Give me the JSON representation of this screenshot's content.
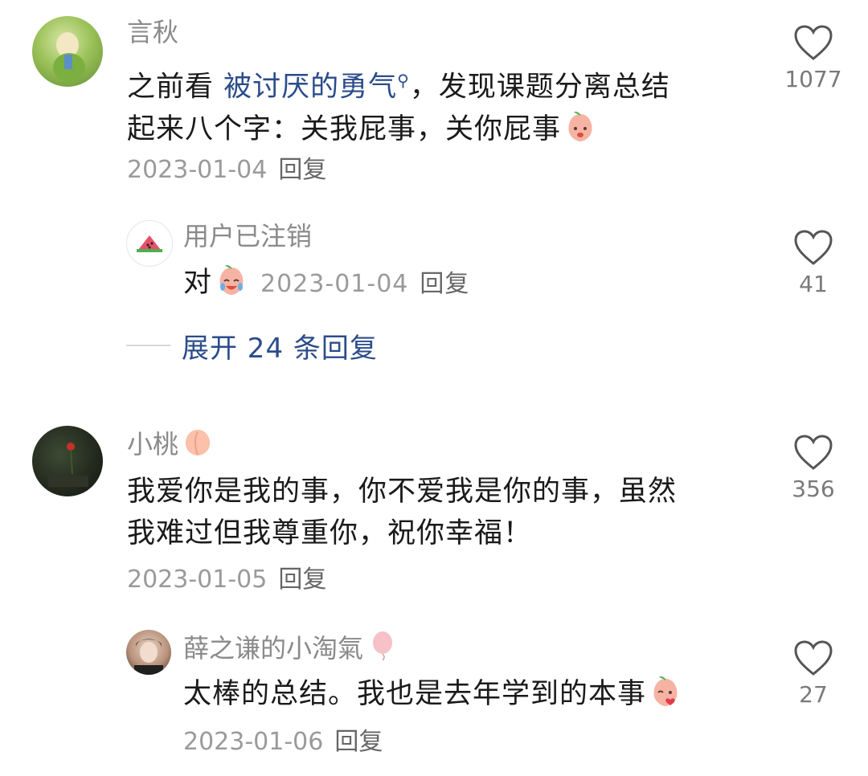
{
  "comments": [
    {
      "username": "言秋",
      "text_before": "之前看 ",
      "link_text": "被讨厌的勇气",
      "text_after_line1": "，发现课题分离总结",
      "text_line2": "起来八个字：关我屁事，关你屁事",
      "date": "2023-01-04",
      "reply_label": "回复",
      "likes": "1077",
      "replies": [
        {
          "username": "用户已注销",
          "text": "对",
          "date": "2023-01-04",
          "reply_label": "回复",
          "likes": "41"
        }
      ],
      "expand_label": "展开 24 条回复"
    },
    {
      "username": "小桃",
      "text_line1": "我爱你是我的事，你不爱我是你的事，虽然",
      "text_line2": "我难过但我尊重你，祝你幸福！",
      "date": "2023-01-05",
      "reply_label": "回复",
      "likes": "356",
      "replies": [
        {
          "username": "薛之谦的小淘氣",
          "text": "太棒的总结。我也是去年学到的本事",
          "date": "2023-01-06",
          "reply_label": "回复",
          "likes": "27"
        }
      ]
    }
  ],
  "icons": {
    "heart": "heart-outline-icon",
    "search": "search-icon",
    "peach_emoji": "peach-emoji-icon",
    "watermelon": "watermelon-avatar-icon",
    "balloon": "balloon-icon"
  },
  "colors": {
    "link": "#2b4c8a",
    "meta": "#9a9a9a",
    "username": "#8a8a8a"
  }
}
